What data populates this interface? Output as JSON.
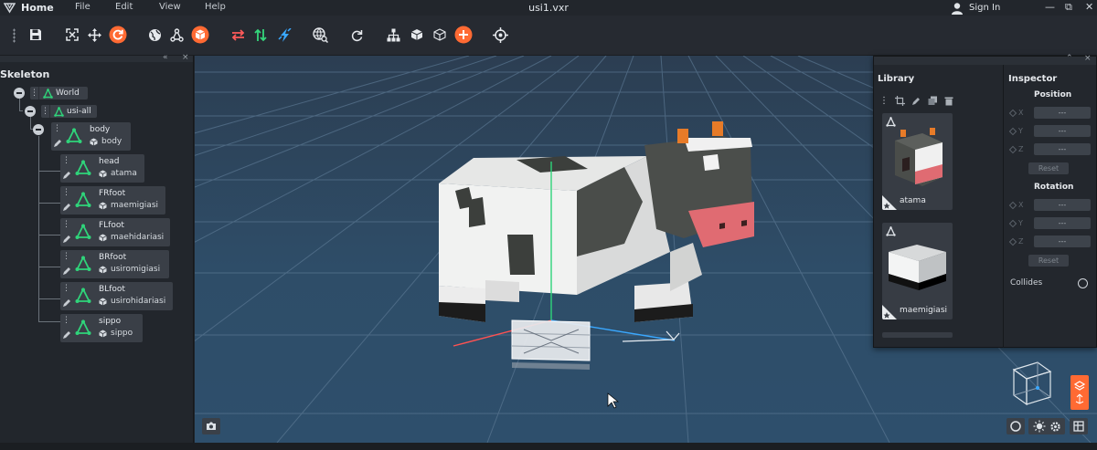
{
  "menubar": {
    "home": "Home",
    "menus": [
      "File",
      "Edit",
      "View",
      "Help"
    ],
    "title": "usi1.vxr",
    "signin": "Sign In",
    "window_controls": [
      "—",
      "⧉",
      "✕"
    ]
  },
  "toolbar": {
    "icons": [
      "save-icon",
      "fit-view-icon",
      "move-icon",
      "refresh-icon",
      "globe-icon",
      "nodes-icon",
      "cube-icon",
      "swap-icon",
      "updown-icon",
      "bolt-icon",
      "globe-search-icon",
      "rotate-icon",
      "hierarchy-icon",
      "solid-cube-icon",
      "wire-cube-icon",
      "add-icon",
      "target-icon"
    ],
    "accent": "#ff6a33"
  },
  "skeleton": {
    "title": "Skeleton",
    "world": "World",
    "group": "usi-all",
    "nodes": [
      {
        "name": "body",
        "mesh": "body"
      },
      {
        "name": "head",
        "mesh": "atama"
      },
      {
        "name": "FRfoot",
        "mesh": "maemigiasi"
      },
      {
        "name": "FLfoot",
        "mesh": "maehidariasi"
      },
      {
        "name": "BRfoot",
        "mesh": "usiromigiasi"
      },
      {
        "name": "BLfoot",
        "mesh": "usirohidariasi"
      },
      {
        "name": "sippo",
        "mesh": "sippo"
      }
    ]
  },
  "library": {
    "title": "Library",
    "items": [
      {
        "name": "atama"
      },
      {
        "name": "maemigiasi"
      }
    ]
  },
  "inspector": {
    "title": "Inspector",
    "position_label": "Position",
    "rotation_label": "Rotation",
    "axes": [
      "X",
      "Y",
      "Z"
    ],
    "position_values": [
      "---",
      "---",
      "---"
    ],
    "rotation_values": [
      "---",
      "---",
      "---"
    ],
    "reset": "Reset",
    "collides": "Collides"
  },
  "colors": {
    "bone": "#2fd47a",
    "accent": "#ff6a33"
  }
}
